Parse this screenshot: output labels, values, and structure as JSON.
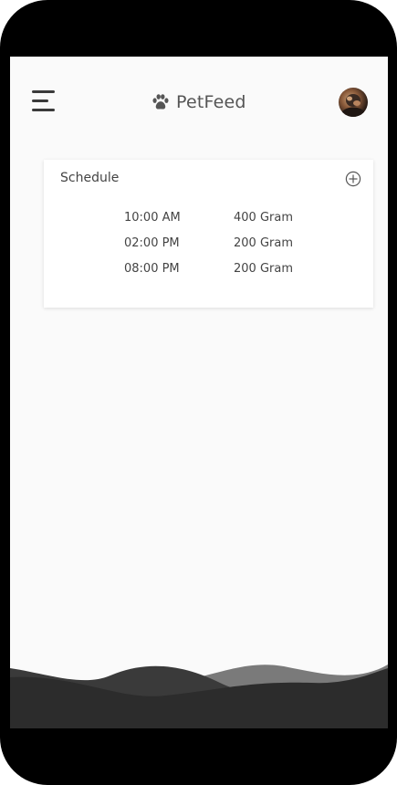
{
  "app": {
    "title": "PetFeed",
    "brand_icon": "paw-icon",
    "menu_icon": "hamburger-menu-icon"
  },
  "colors": {
    "frame": "#000000",
    "screen_bg": "#fafafa",
    "text": "#444444",
    "wave_dark": "#2c2c2c",
    "wave_mid": "#3d3d3d",
    "wave_light": "#7a7a7a"
  },
  "schedule": {
    "title": "Schedule",
    "add_icon": "add-circle-icon",
    "rows": [
      {
        "time": "10:00 AM",
        "amount": "400 Gram"
      },
      {
        "time": "02:00 PM",
        "amount": "200 Gram"
      },
      {
        "time": "08:00 PM",
        "amount": "200 Gram"
      }
    ]
  }
}
